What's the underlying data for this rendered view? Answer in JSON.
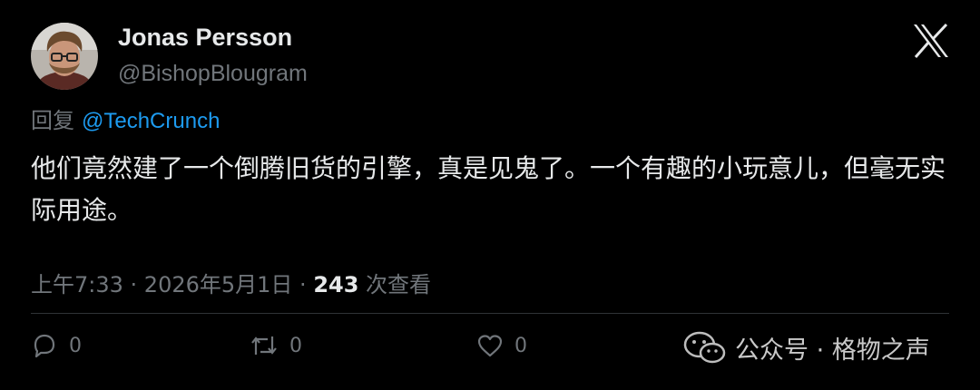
{
  "author": {
    "display_name": "Jonas Persson",
    "handle": "@BishopBlougram"
  },
  "reply": {
    "prefix": "回复",
    "mention": "@TechCrunch"
  },
  "tweet": {
    "text": "他们竟然建了一个倒腾旧货的引擎，真是见鬼了。一个有趣的小玩意儿，但毫无实际用途。"
  },
  "meta": {
    "time": "上午7:33",
    "separator1": " · ",
    "date": "2026年5月1日",
    "separator2": " · ",
    "views_count": "243",
    "views_label": " 次查看"
  },
  "actions": {
    "reply_count": "0",
    "repost_count": "0",
    "like_count": "0"
  },
  "watermark": {
    "text": "公众号 · 格物之声"
  },
  "colors": {
    "background": "#000000",
    "primary_text": "#e7e9ea",
    "secondary_text": "#71767b",
    "link": "#1d9bf0",
    "divider": "#2f3336"
  },
  "icons": {
    "logo": "x-logo-icon",
    "reply": "speech-bubble-icon",
    "repost": "repost-arrows-icon",
    "like": "heart-icon",
    "watermark": "wechat-icon"
  }
}
